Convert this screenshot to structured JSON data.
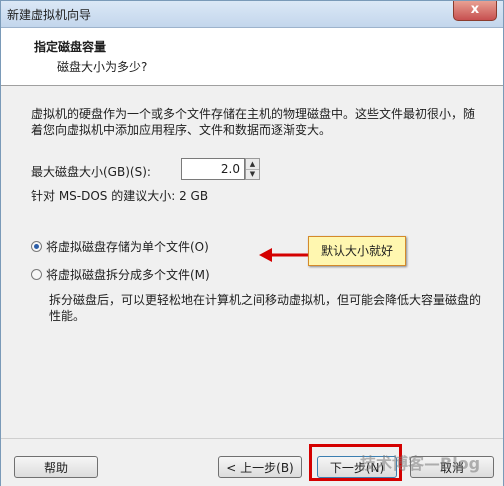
{
  "window": {
    "title": "新建虚拟机向导",
    "close_label": "x"
  },
  "header": {
    "title": "指定磁盘容量",
    "subtitle": "磁盘大小为多少?"
  },
  "description": "虚拟机的硬盘作为一个或多个文件存储在主机的物理磁盘中。这些文件最初很小，随着您向虚拟机中添加应用程序、文件和数据而逐渐变大。",
  "max_disk": {
    "label": "最大磁盘大小(GB)(S):",
    "value": "2.0"
  },
  "recommendation": "针对 MS-DOS 的建议大小: 2 GB",
  "options": [
    {
      "label": "将虚拟磁盘存储为单个文件(O)",
      "selected": true
    },
    {
      "label": "将虚拟磁盘拆分成多个文件(M)",
      "selected": false
    }
  ],
  "split_note": "拆分磁盘后，可以更轻松地在计算机之间移动虚拟机，但可能会降低大容量磁盘的性能。",
  "callout": "默认大小就好",
  "buttons": {
    "help": "帮助",
    "back": "< 上一步(B)",
    "next": "下一步(N)",
    "cancel": "取消"
  },
  "watermark": "技术博客—Blog",
  "colors": {
    "callout_bg": "#fff7b0",
    "highlight": "#d40000",
    "arrow": "#d40000"
  }
}
